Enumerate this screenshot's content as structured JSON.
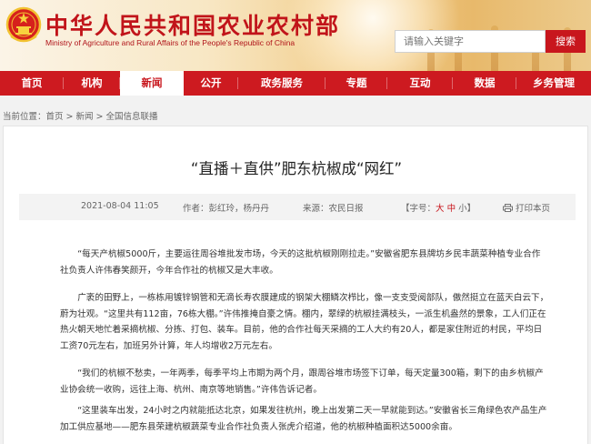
{
  "header": {
    "site_title": "中华人民共和国农业农村部",
    "site_subtitle": "Ministry of Agriculture and Rural Affairs of the People's Republic of China",
    "search_placeholder": "请输入关键字",
    "search_button": "搜索"
  },
  "nav": {
    "items": [
      {
        "label": "首页"
      },
      {
        "label": "机构"
      },
      {
        "label": "新闻"
      },
      {
        "label": "公开"
      },
      {
        "label": "政务服务"
      },
      {
        "label": "专题"
      },
      {
        "label": "互动"
      },
      {
        "label": "数据"
      },
      {
        "label": "乡务管理"
      }
    ],
    "active_index": 2
  },
  "breadcrumb": {
    "prefix": "当前位置：",
    "items": [
      "首页",
      "新闻",
      "全国信息联播"
    ],
    "separator": ">"
  },
  "article": {
    "title": "“直播＋直供”肥东杭椒成“网红”",
    "date": "2021-08-04 11:05",
    "author": "作者：彭红玲，杨丹丹",
    "source": "来源：农民日报",
    "font_size_label": "【字号：",
    "font_large": "大",
    "font_medium": "中",
    "font_small": "小",
    "font_close": "】",
    "print_label": "打印本页",
    "paragraphs": [
      "“每天产杭椒5000斤，主要运往周谷堆批发市场，今天的这批杭椒刚刚拉走。”安徽省肥东县牌坊乡民丰蔬菜种植专业合作社负责人许伟春笑颜开，今年合作社的杭椒又是大丰收。",
      "广袤的田野上，一栋栋用镀锌钢管和无滴长寿农膜建成的钢架大棚鳞次栉比，像一支支受阅部队，傲然挺立在蓝天白云下，蔚为壮观。“这里共有112亩，76栋大棚。”许伟推掩自豪之情。棚内，翠绿的杭椒挂满枝头，一派生机盎然的景象，工人们正在热火朝天地忙着采摘杭椒、分拣、打包、装车。目前，他的合作社每天采摘的工人大约有20人，都是家住附近的村民，平均日工资70元左右，加班另外计算，年人均增收2万元左右。",
      "“我们的杭椒不愁卖，一年两季，每季平均上市期为两个月，跟周谷堆市场签下订单，每天定量300箱，剩下的由乡杭椒产业协会统一收购，远往上海、杭州、南京等地销售。”许伟告诉记者。",
      "“这里装车出发，24小时之内就能抵达北京，如果发往杭州，晚上出发第二天一早就能到达。”安徽省长三角绿色农产品生产加工供应基地——肥东县荣建杭椒蔬菜专业合作社负责人张虎介绍道，他的杭椒种植面积达5000余亩。"
    ]
  },
  "colors": {
    "brand_red": "#c8161d",
    "nav_red": "#cd1a20"
  }
}
